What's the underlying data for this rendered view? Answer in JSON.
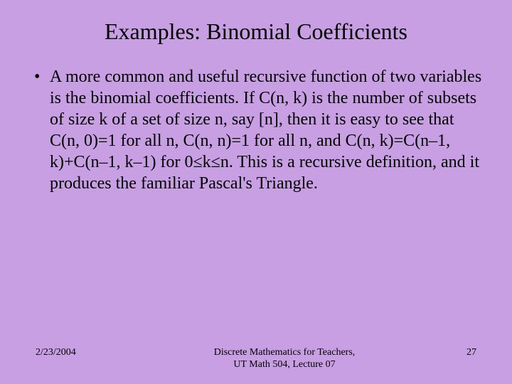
{
  "slide": {
    "title": "Examples: Binomial Coefficients",
    "bullets": [
      {
        "text": "A more common and useful recursive function of two variables is the binomial coefficients. If C(n, k) is the number of subsets of size k of a set of size n, say [n], then it is easy to see that C(n, 0)=1 for all n, C(n, n)=1 for all n, and C(n, k)=C(n–1, k)+C(n–1, k–1) for 0≤k≤n. This is a recursive definition, and it produces the familiar Pascal's Triangle."
      }
    ]
  },
  "footer": {
    "date": "2/23/2004",
    "center_line1": "Discrete Mathematics for Teachers,",
    "center_line2": "UT Math 504, Lecture 07",
    "page": "27"
  }
}
